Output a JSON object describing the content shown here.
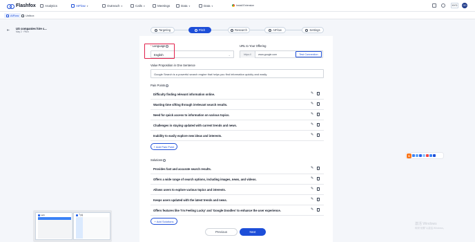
{
  "app": {
    "logo": "Flashfox"
  },
  "nav": [
    {
      "label": "Analytics",
      "caret": ""
    },
    {
      "label": "AIFlow",
      "caret": "▾"
    },
    {
      "label": "Outreach",
      "caret": "▾"
    },
    {
      "label": "Calls",
      "caret": "▾"
    },
    {
      "label": "Meetings",
      "caret": ""
    },
    {
      "label": "Data",
      "caret": "▾"
    },
    {
      "label": "Data",
      "caret": "▾"
    }
  ],
  "extension": "Install Extension",
  "user": {
    "menu": "MYD",
    "initials": "GD"
  },
  "window_tabs": [
    "AIFlow",
    "Unibox"
  ],
  "campaign": {
    "title": "US companies hire c...",
    "subtitle": "May 2 · Pitch"
  },
  "steps": [
    "Targeting",
    "Pitch",
    "Research",
    "AIFlow",
    "Settings"
  ],
  "form": {
    "language_label": "Language",
    "language_value": "English",
    "url_label": "URL to Your Offering",
    "url_prefix": "https://",
    "url_value": "www.google.com",
    "test_button": "Test Connection",
    "vp_label": "Value Proposition in One Sentence",
    "vp_value": "Google Search is a powerful search engine that helps you find information quickly and easily."
  },
  "pain_points": {
    "label": "Pain Points",
    "items": [
      "Difficulty finding relevant information online.",
      "Wasting time sifting through irrelevant search results.",
      "Need for quick access to information on various topics.",
      "Challenges in staying updated with current trends and news.",
      "Inability to easily explore new ideas and interests."
    ],
    "add_button": "+ Add Pain Point"
  },
  "solutions": {
    "label": "Solutions",
    "items": [
      "Provides fast and accurate search results.",
      "Offers a wide range of search options, including images, news, and videos.",
      "Allows users to explore various topics and interests.",
      "Keeps users updated with the latest trends and news.",
      "Offers features like 'I'm Feeling Lucky' and 'Google Doodles' to enhance the user experience."
    ],
    "add_button": "+ Add Solutions"
  },
  "footer": {
    "previous": "Previous",
    "next": "Next"
  },
  "overlay": {
    "watermark_title": "激活 Windows",
    "watermark_sub": "转到“设置”以激活 Windows。",
    "thumb_titles": [
      "Lark",
      "飞书"
    ],
    "ime_logo": "S"
  }
}
